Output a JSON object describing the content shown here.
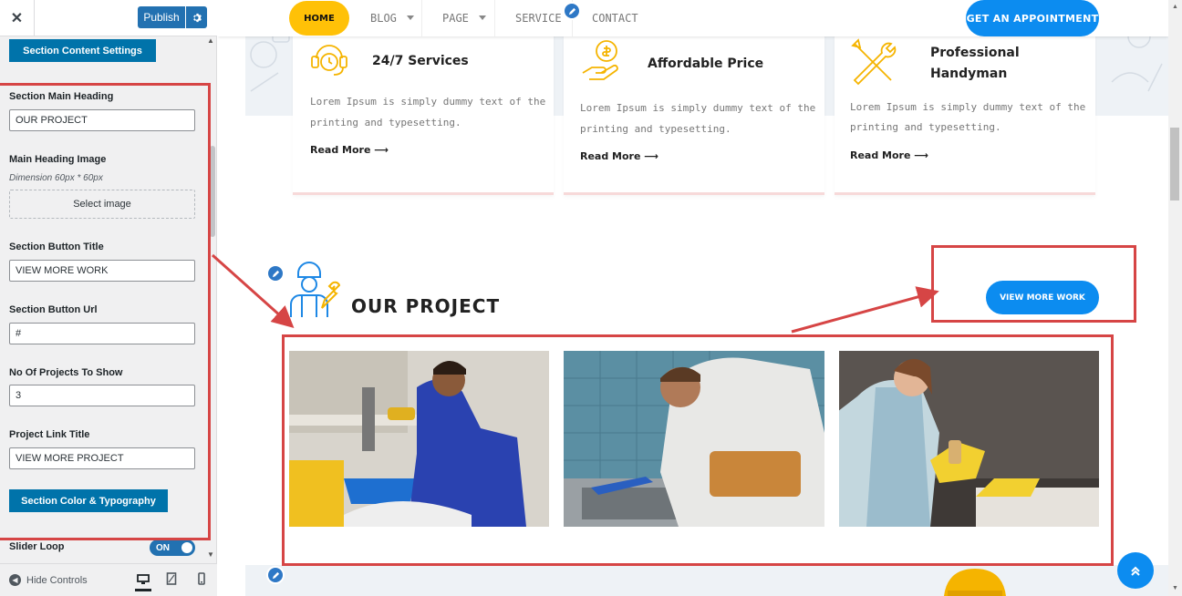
{
  "sidebar": {
    "close_icon": "close-icon",
    "publish_label": "Publish",
    "section_content_settings": "Section Content Settings",
    "main_heading_label": "Section Main Heading",
    "main_heading_value": "OUR PROJECT",
    "heading_image_label": "Main Heading Image",
    "heading_image_note": "Dimension 60px * 60px",
    "select_image_label": "Select image",
    "button_title_label": "Section Button Title",
    "button_title_value": "VIEW MORE WORK",
    "button_url_label": "Section Button Url",
    "button_url_value": "#",
    "projects_count_label": "No Of Projects To Show",
    "projects_count_value": "3",
    "project_link_label": "Project Link Title",
    "project_link_value": "VIEW MORE PROJECT",
    "color_typography_label": "Section Color & Typography",
    "slider_loop_label": "Slider Loop",
    "slider_loop_value": "ON",
    "hide_controls_label": "Hide Controls"
  },
  "nav": {
    "items": [
      "HOME",
      "BLOG",
      "PAGE",
      "SERVICE",
      "CONTACT"
    ],
    "cta": "GET AN APPOINTMENT"
  },
  "services": [
    {
      "title": "24/7 Services",
      "text_line1": "Lorem Ipsum is simply dummy text of the",
      "text_line2": "printing and typesetting.",
      "more": "Read More"
    },
    {
      "title": "Affordable Price",
      "text_line1": "Lorem Ipsum is simply dummy text of the",
      "text_line2": "printing and typesetting.",
      "more": "Read More"
    },
    {
      "title_line1": "Professional",
      "title_line2": "Handyman",
      "text_line1": "Lorem Ipsum is simply dummy text of the",
      "text_line2": "printing and typesetting.",
      "more": "Read More"
    }
  ],
  "project": {
    "title": "OUR PROJECT",
    "button": "VIEW MORE WORK"
  },
  "colors": {
    "accent_blue": "#0c8cf0",
    "accent_yellow": "#ffc107",
    "wp_blue": "#2271b1",
    "annotation_red": "#d64545"
  }
}
